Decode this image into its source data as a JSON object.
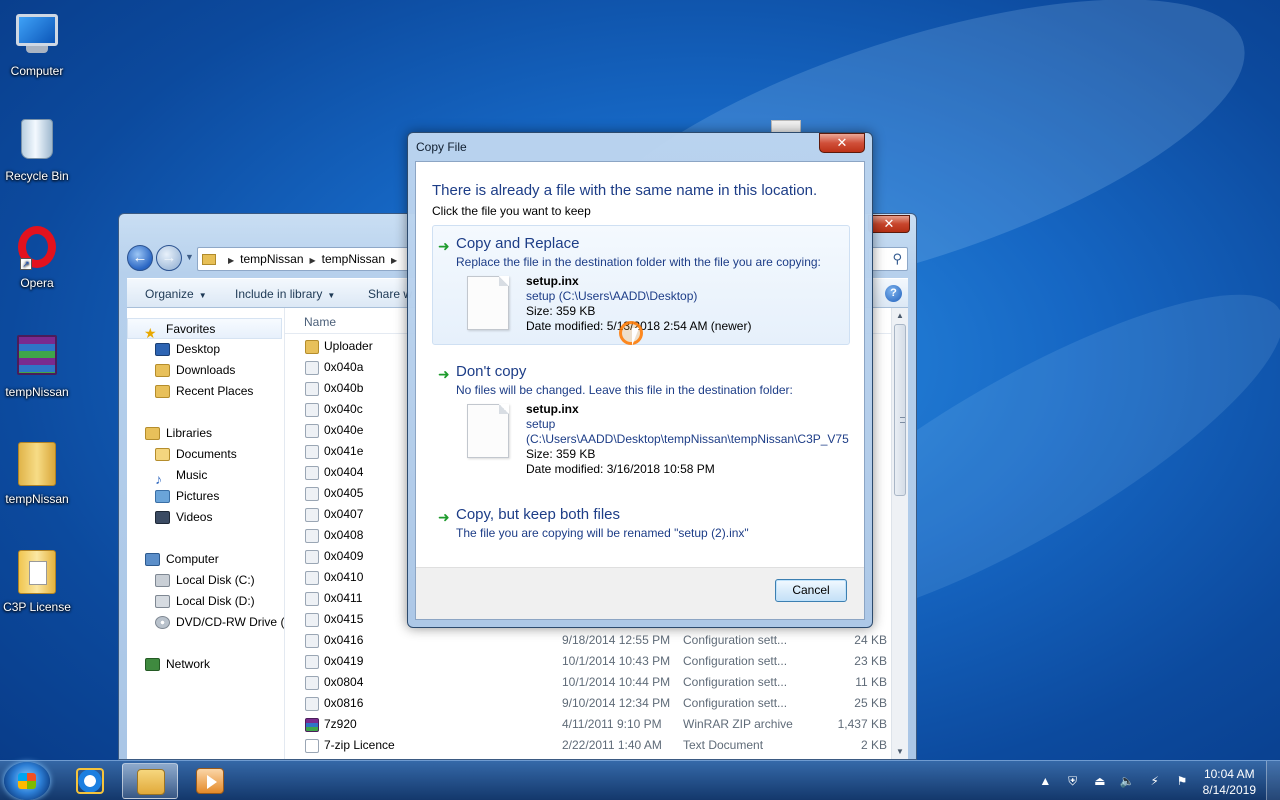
{
  "desktop": {
    "icons": [
      {
        "label": "Computer",
        "icon": "computer-icon"
      },
      {
        "label": "Recycle Bin",
        "icon": "recycle-bin-icon"
      },
      {
        "label": "Opera",
        "icon": "opera-icon"
      },
      {
        "label": "tempNissan",
        "icon": "winrar-archive-icon"
      },
      {
        "label": "tempNissan",
        "icon": "folder-icon"
      },
      {
        "label": "C3P License",
        "icon": "folder-icon"
      }
    ]
  },
  "explorer": {
    "close_label": "✕",
    "breadcrumb": [
      "tempNissan",
      "tempNissan"
    ],
    "toolbar": {
      "organize": "Organize",
      "include_in_library": "Include in library",
      "share_with": "Share w"
    },
    "help_label": "?",
    "nav": {
      "favorites": "Favorites",
      "desktop": "Desktop",
      "downloads": "Downloads",
      "recent_places": "Recent Places",
      "libraries": "Libraries",
      "documents": "Documents",
      "music": "Music",
      "pictures": "Pictures",
      "videos": "Videos",
      "computer": "Computer",
      "local_disk_c": "Local Disk (C:)",
      "local_disk_d": "Local Disk (D:)",
      "dvd_drive": "DVD/CD-RW Drive (I",
      "network": "Network"
    },
    "columns": {
      "name": "Name"
    },
    "files": [
      {
        "name": "Uploader",
        "type_icon": "folder",
        "date": "",
        "type": "",
        "size": ""
      },
      {
        "name": "0x040a",
        "type_icon": "cfg",
        "date": "",
        "type": "",
        "size": ""
      },
      {
        "name": "0x040b",
        "type_icon": "cfg",
        "date": "",
        "type": "",
        "size": ""
      },
      {
        "name": "0x040c",
        "type_icon": "cfg",
        "date": "",
        "type": "",
        "size": ""
      },
      {
        "name": "0x040e",
        "type_icon": "cfg",
        "date": "",
        "type": "",
        "size": ""
      },
      {
        "name": "0x041e",
        "type_icon": "cfg",
        "date": "",
        "type": "",
        "size": ""
      },
      {
        "name": "0x0404",
        "type_icon": "cfg",
        "date": "",
        "type": "",
        "size": ""
      },
      {
        "name": "0x0405",
        "type_icon": "cfg",
        "date": "",
        "type": "",
        "size": ""
      },
      {
        "name": "0x0407",
        "type_icon": "cfg",
        "date": "",
        "type": "",
        "size": ""
      },
      {
        "name": "0x0408",
        "type_icon": "cfg",
        "date": "",
        "type": "",
        "size": ""
      },
      {
        "name": "0x0409",
        "type_icon": "cfg",
        "date": "",
        "type": "",
        "size": ""
      },
      {
        "name": "0x0410",
        "type_icon": "cfg",
        "date": "",
        "type": "",
        "size": ""
      },
      {
        "name": "0x0411",
        "type_icon": "cfg",
        "date": "",
        "type": "",
        "size": ""
      },
      {
        "name": "0x0415",
        "type_icon": "cfg",
        "date": "",
        "type": "",
        "size": ""
      },
      {
        "name": "0x0416",
        "type_icon": "cfg",
        "date": "9/18/2014 12:55 PM",
        "type": "Configuration sett...",
        "size": "24 KB"
      },
      {
        "name": "0x0419",
        "type_icon": "cfg",
        "date": "10/1/2014 10:43 PM",
        "type": "Configuration sett...",
        "size": "23 KB"
      },
      {
        "name": "0x0804",
        "type_icon": "cfg",
        "date": "10/1/2014 10:44 PM",
        "type": "Configuration sett...",
        "size": "11 KB"
      },
      {
        "name": "0x0816",
        "type_icon": "cfg",
        "date": "9/10/2014 12:34 PM",
        "type": "Configuration sett...",
        "size": "25 KB"
      },
      {
        "name": "7z920",
        "type_icon": "rar",
        "date": "4/11/2011 9:10 PM",
        "type": "WinRAR ZIP archive",
        "size": "1,437 KB"
      },
      {
        "name": "7-zip Licence",
        "type_icon": "txt",
        "date": "2/22/2011 1:40 AM",
        "type": "Text Document",
        "size": "2 KB"
      }
    ]
  },
  "dialog": {
    "title": "Copy File",
    "close_label": "✕",
    "heading": "There is already a file with the same name in this location.",
    "subheading": "Click the file you want to keep",
    "options": {
      "replace": {
        "title": "Copy and Replace",
        "description": "Replace the file in the destination folder with the file you are copying:",
        "file_name": "setup.inx",
        "file_path": "setup (C:\\Users\\AADD\\Desktop)",
        "size": "Size: 359 KB",
        "date": "Date modified: 5/13/2018 2:54 AM (newer)"
      },
      "dont_copy": {
        "title": "Don't copy",
        "description": "No files will be changed. Leave this file in the destination folder:",
        "file_name": "setup.inx",
        "file_path_1": "setup",
        "file_path_2": "(C:\\Users\\AADD\\Desktop\\tempNissan\\tempNissan\\C3P_V75",
        "size": "Size: 359 KB",
        "date": "Date modified: 3/16/2018 10:58 PM"
      },
      "keep_both": {
        "title": "Copy, but keep both files",
        "description": "The file you are copying will be renamed \"setup (2).inx\""
      }
    },
    "cancel_label": "Cancel"
  },
  "taskbar": {
    "apps": [
      "internet-explorer-icon",
      "windows-explorer-icon",
      "media-player-icon"
    ],
    "clock": {
      "time": "10:04 AM",
      "date": "8/14/2019"
    }
  },
  "colors": {
    "dialog_link": "#1d3d87",
    "desktop_bg": "#1667c4",
    "green_arrow": "#1d9b2c"
  }
}
